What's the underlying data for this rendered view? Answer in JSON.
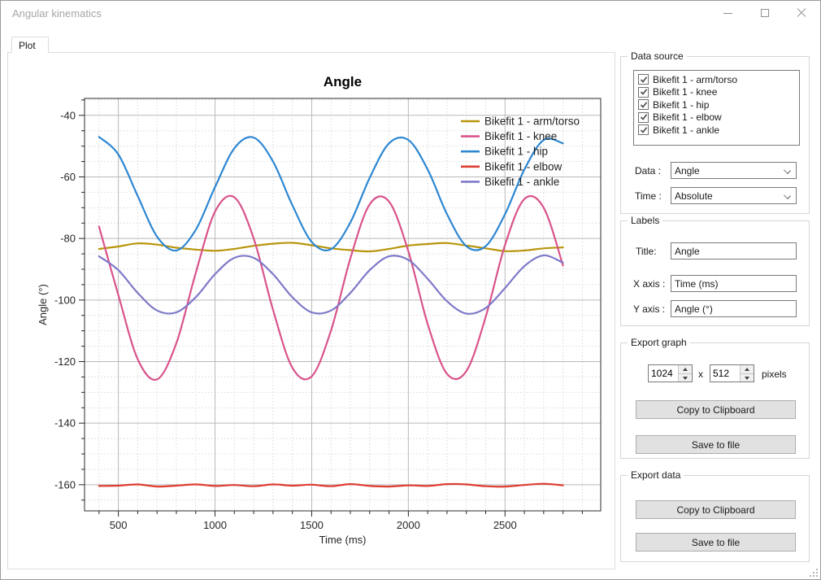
{
  "window": {
    "title": "Angular kinematics",
    "controls": {
      "minimize": "minimize",
      "maximize": "maximize",
      "close": "close"
    }
  },
  "tab": {
    "label": "Plot"
  },
  "chart_data": {
    "type": "line",
    "title": "Angle",
    "xlabel": "Time (ms)",
    "ylabel": "Angle (°)",
    "grid": true,
    "legend_position": "top-right",
    "x_range": [
      325,
      2995
    ],
    "y_range": [
      -168.5,
      -34.5
    ],
    "x_ticks_major": [
      500,
      1000,
      1500,
      2000,
      2500
    ],
    "x_minor_step": 100,
    "y_ticks_major": [
      -160,
      -140,
      -120,
      -100,
      -80,
      -60,
      -40
    ],
    "y_minor_step": 5,
    "x": [
      400,
      500,
      600,
      700,
      800,
      900,
      1000,
      1100,
      1200,
      1300,
      1400,
      1500,
      1600,
      1700,
      1800,
      1900,
      2000,
      2100,
      2200,
      2300,
      2400,
      2500,
      2600,
      2700,
      2800
    ],
    "series": [
      {
        "name": "Bikefit 1 - arm/torso",
        "color": "#b8950d",
        "values": [
          -83.4,
          -82.6,
          -81.6,
          -82.0,
          -83.0,
          -83.6,
          -84.0,
          -83.4,
          -82.4,
          -81.7,
          -81.4,
          -82.2,
          -83.2,
          -83.8,
          -84.2,
          -83.4,
          -82.3,
          -81.8,
          -81.5,
          -82.3,
          -83.2,
          -84.1,
          -83.9,
          -83.2,
          -82.9
        ]
      },
      {
        "name": "Bikefit 1 - knee",
        "color": "#d9538c",
        "values": [
          -76.1,
          -98.4,
          -119.2,
          -125.8,
          -114.0,
          -91.2,
          -71.3,
          -66.6,
          -80.0,
          -103.2,
          -122.0,
          -124.8,
          -109.9,
          -86.5,
          -68.9,
          -68.0,
          -84.2,
          -107.8,
          -124.0,
          -123.1,
          -105.5,
          -82.1,
          -67.2,
          -70.0,
          -88.8
        ]
      },
      {
        "name": "Bikefit 1 - hip",
        "color": "#2e87d2",
        "values": [
          -47.0,
          -52.7,
          -66.2,
          -79.4,
          -83.9,
          -77.2,
          -63.3,
          -50.7,
          -47.2,
          -55.0,
          -69.2,
          -81.1,
          -83.5,
          -74.8,
          -60.3,
          -49.1,
          -48.0,
          -57.6,
          -72.1,
          -82.5,
          -82.5,
          -72.1,
          -57.6,
          -48.0,
          -49.1
        ]
      },
      {
        "name": "Bikefit 1 - elbow",
        "color": "#de3d32",
        "values": [
          -160.4,
          -160.3,
          -159.9,
          -160.6,
          -160.3,
          -159.9,
          -160.4,
          -160.1,
          -160.5,
          -159.9,
          -160.3,
          -160.0,
          -160.5,
          -159.8,
          -160.4,
          -160.6,
          -160.2,
          -160.4,
          -159.8,
          -159.9,
          -160.5,
          -160.6,
          -160.1,
          -159.7,
          -160.2
        ]
      },
      {
        "name": "Bikefit 1 - ankle",
        "color": "#7e79c8",
        "values": [
          -85.8,
          -90.3,
          -97.7,
          -103.4,
          -104.0,
          -99.1,
          -91.6,
          -86.3,
          -86.3,
          -91.6,
          -99.1,
          -104.0,
          -103.4,
          -97.7,
          -90.3,
          -85.8,
          -87.0,
          -93.1,
          -100.4,
          -104.4,
          -102.6,
          -96.1,
          -89.0,
          -85.5,
          -87.9
        ]
      }
    ]
  },
  "panel": {
    "data_source": {
      "group_label": "Data source",
      "items": [
        {
          "label": "Bikefit 1 - arm/torso",
          "checked": true
        },
        {
          "label": "Bikefit 1 - knee",
          "checked": true
        },
        {
          "label": "Bikefit 1 - hip",
          "checked": true
        },
        {
          "label": "Bikefit 1 - elbow",
          "checked": true
        },
        {
          "label": "Bikefit 1 - ankle",
          "checked": true
        }
      ],
      "data_label": "Data :",
      "data_value": "Angle",
      "time_label": "Time :",
      "time_value": "Absolute"
    },
    "labels": {
      "group_label": "Labels",
      "title_label": "Title:",
      "title_value": "Angle",
      "xaxis_label": "X axis :",
      "xaxis_value": "Time (ms)",
      "yaxis_label": "Y axis :",
      "yaxis_value": "Angle (°)"
    },
    "export_graph": {
      "group_label": "Export graph",
      "width_value": "1024",
      "times_label": "x",
      "height_value": "512",
      "pixels_label": "pixels",
      "copy_button": "Copy to Clipboard",
      "save_button": "Save to file"
    },
    "export_data": {
      "group_label": "Export data",
      "copy_button": "Copy to Clipboard",
      "save_button": "Save to file"
    }
  }
}
